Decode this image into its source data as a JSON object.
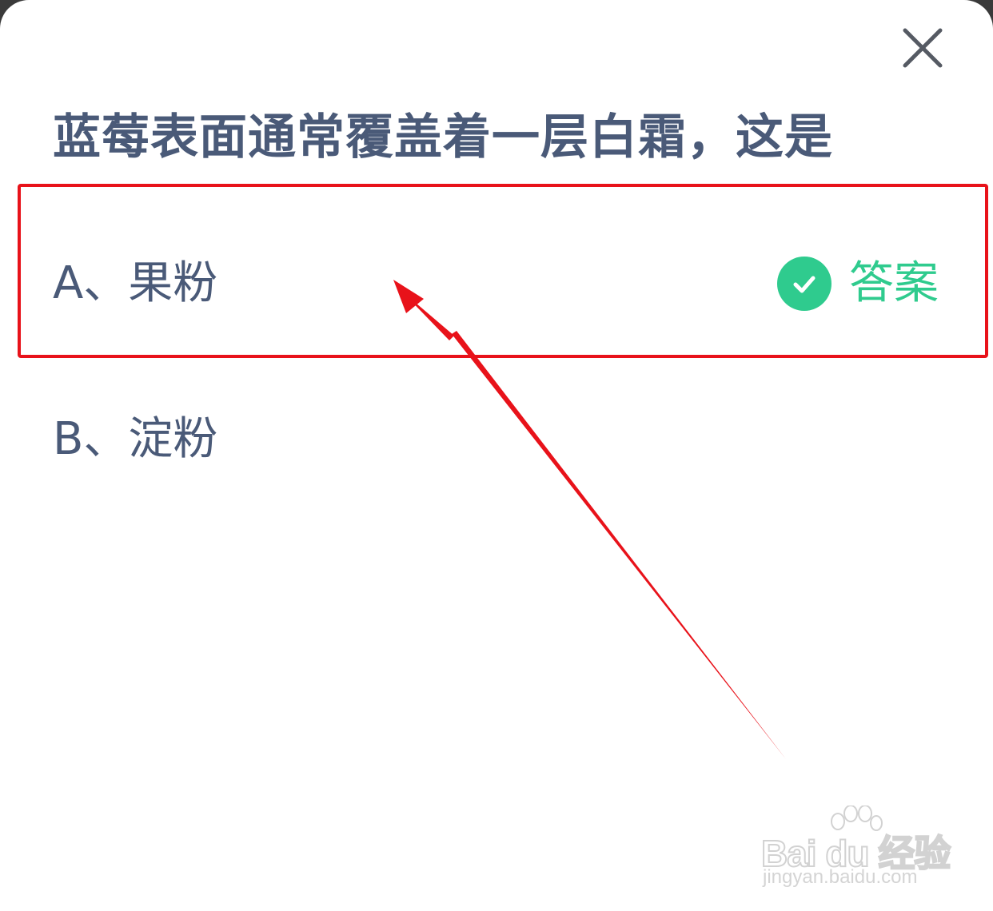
{
  "question": {
    "title": "蓝莓表面通常覆盖着一层白霜，这是"
  },
  "options": [
    {
      "label": "A、果粉",
      "is_answer": true,
      "answer_tag": "答案"
    },
    {
      "label": "B、淀粉",
      "is_answer": false
    }
  ],
  "icons": {
    "close": "close-icon",
    "check": "check-circle-icon"
  },
  "colors": {
    "question_text": "#4a5a78",
    "answer_green": "#2fcb8e",
    "annotation_red": "#e8121a"
  },
  "watermark": {
    "brand": "Bai du 经验",
    "url": "jingyan.baidu.com"
  }
}
